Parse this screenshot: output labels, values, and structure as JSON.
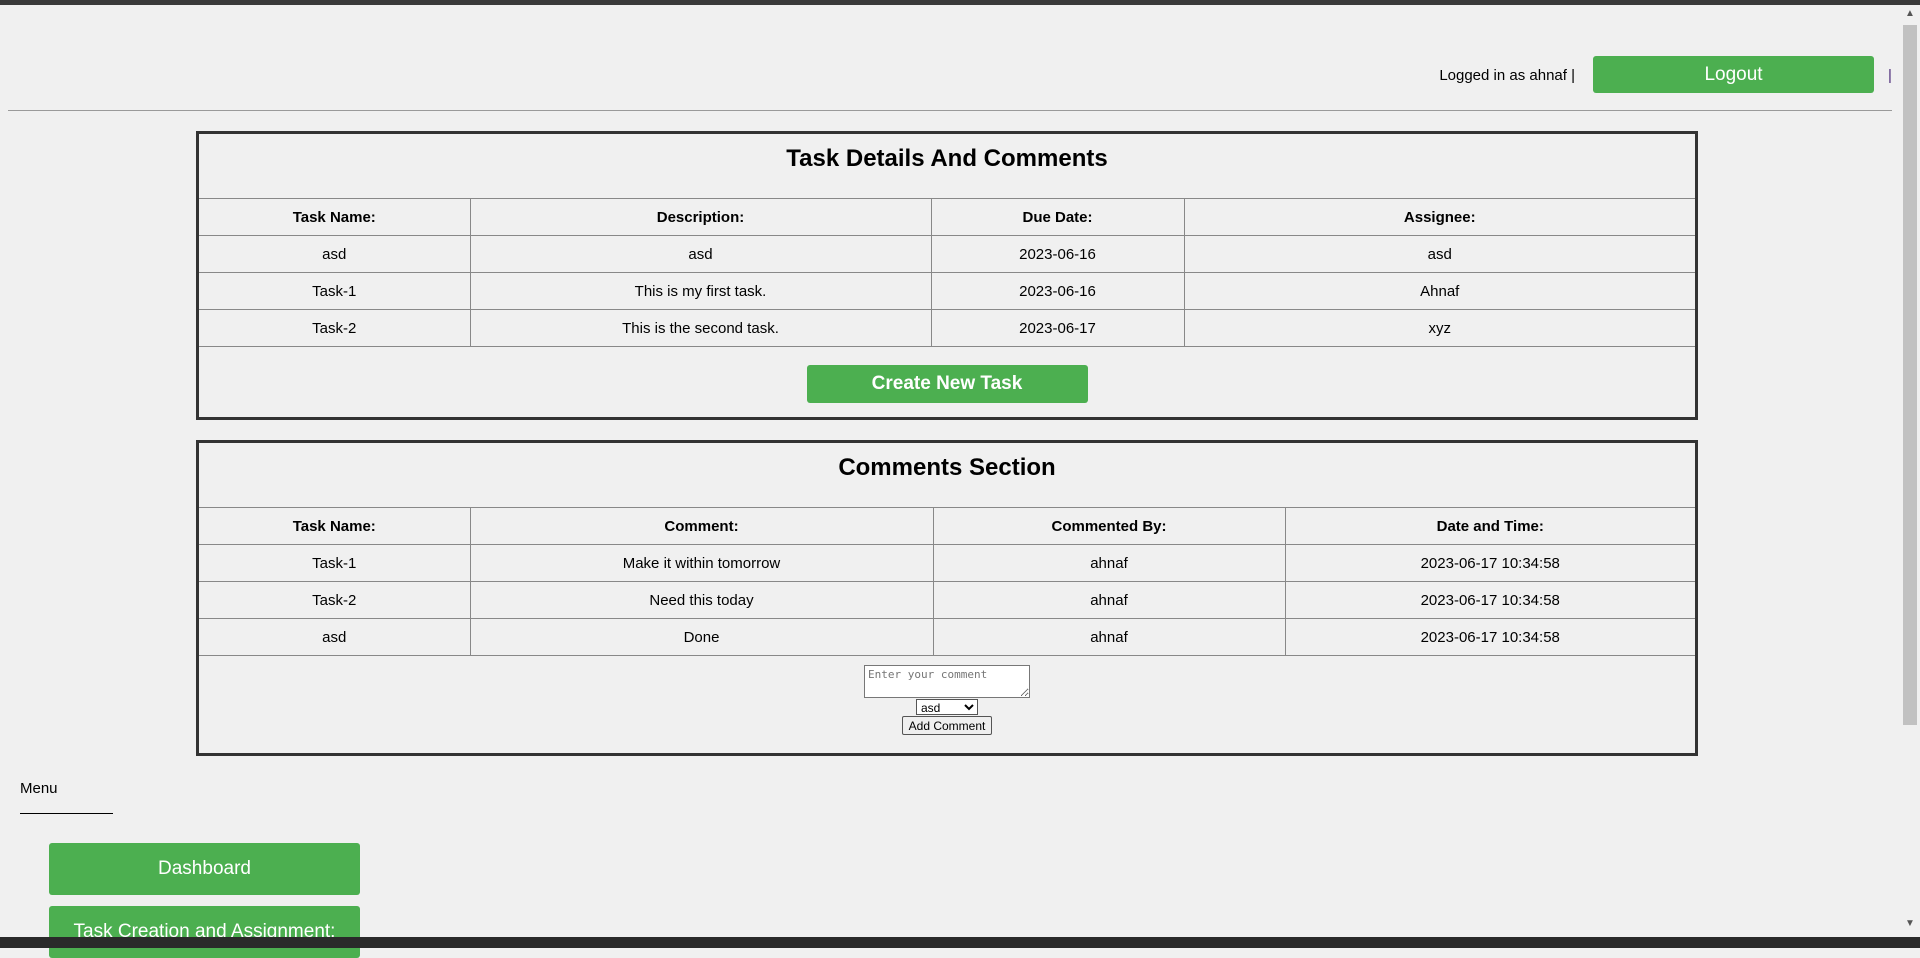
{
  "header": {
    "logged_in_text": "Logged in as ahnaf |",
    "logout_label": "Logout",
    "pipe": "|"
  },
  "task_details": {
    "title": "Task Details And Comments",
    "columns": [
      "Task Name:",
      "Description:",
      "Due Date:",
      "Assignee:"
    ],
    "rows": [
      [
        "asd",
        "asd",
        "2023-06-16",
        "asd"
      ],
      [
        "Task-1",
        "This is my first task.",
        "2023-06-16",
        "Ahnaf"
      ],
      [
        "Task-2",
        "This is the second task.",
        "2023-06-17",
        "xyz"
      ]
    ],
    "create_label": "Create New Task"
  },
  "comments": {
    "title": "Comments Section",
    "columns": [
      "Task Name:",
      "Comment:",
      "Commented By:",
      "Date and Time:"
    ],
    "rows": [
      [
        "Task-1",
        "Make it within tomorrow",
        "ahnaf",
        "2023-06-17 10:34:58"
      ],
      [
        "Task-2",
        "Need this today",
        "ahnaf",
        "2023-06-17 10:34:58"
      ],
      [
        "asd",
        "Done",
        "ahnaf",
        "2023-06-17 10:34:58"
      ]
    ],
    "comment_placeholder": "Enter your comment",
    "selected_task": "asd",
    "add_label": "Add Comment"
  },
  "menu": {
    "label": "Menu",
    "items": [
      "Dashboard",
      "Task Creation and Assignment:"
    ]
  },
  "colors": {
    "accent": "#4caf50"
  }
}
